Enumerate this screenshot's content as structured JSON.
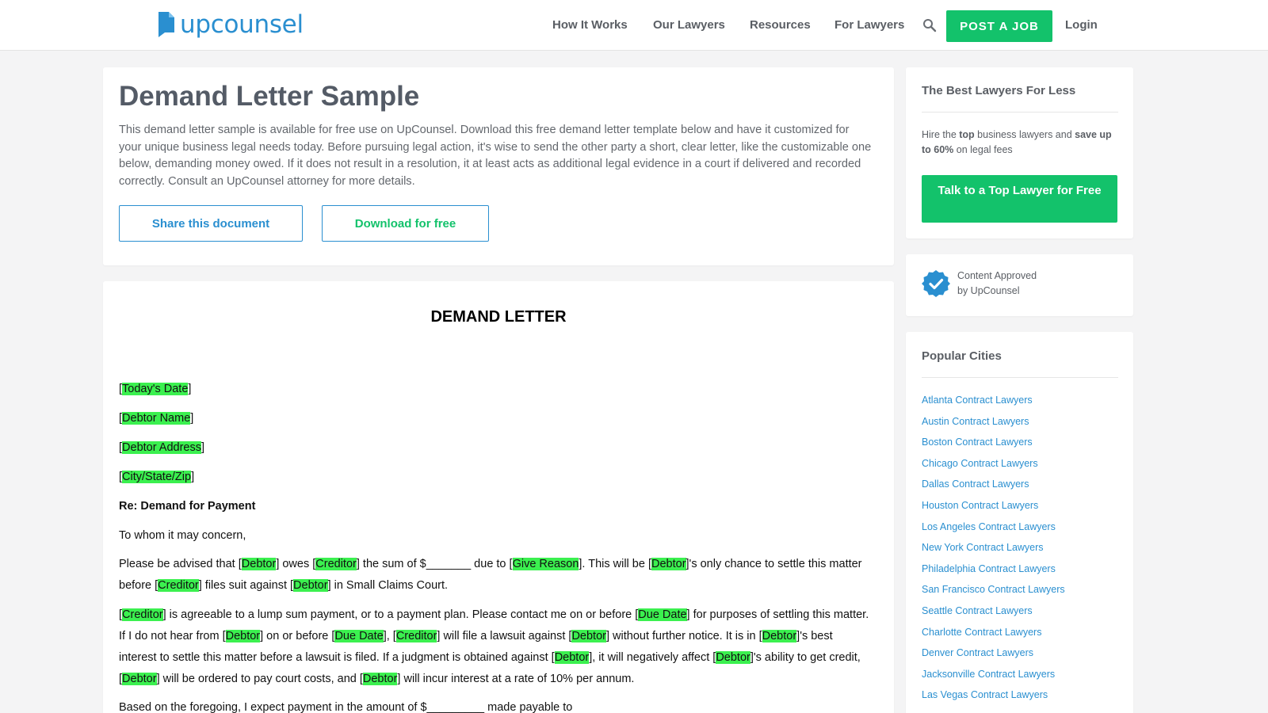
{
  "header": {
    "logo_text": "upcounsel",
    "nav": [
      "How It Works",
      "Our Lawyers",
      "Resources",
      "For Lawyers"
    ],
    "post_job": "POST A JOB",
    "login": "Login",
    "icons": [
      "logo-icon",
      "search-icon"
    ]
  },
  "intro": {
    "title": "Demand Letter Sample",
    "description": "This demand letter sample is available for free use on UpCounsel. Download this free demand letter template below and have it customized for your unique business legal needs today. Before pursuing legal action, it's wise to send the other party a short, clear letter, like the customizable one below, demanding money owed. If it does not result in a resolution, it at least acts as additional legal evidence in a court if delivered and recorded correctly. Consult an UpCounsel attorney for more details.",
    "share": "Share this document",
    "download": "Download for free"
  },
  "letter": {
    "title": "DEMAND LETTER",
    "fields": [
      "Today's Date",
      "Debtor Name",
      "Debtor Address",
      "City/State/Zip"
    ],
    "re": "Re: Demand for Payment",
    "greeting": "To whom it may concern,",
    "p1": [
      {
        "t": "Please be advised that ["
      },
      {
        "h": "Debtor"
      },
      {
        "t": "] owes ["
      },
      {
        "h": "Creditor"
      },
      {
        "t": "] the sum of $_______ due to ["
      },
      {
        "h": "Give Reason"
      },
      {
        "t": "]. This will be ["
      },
      {
        "h": "Debtor"
      },
      {
        "t": "]'s only chance to settle this matter"
      }
    ],
    "p1b": [
      {
        "t": "before ["
      },
      {
        "h": "Creditor"
      },
      {
        "t": "] files suit against ["
      },
      {
        "h": "Debtor"
      },
      {
        "t": "] in Small Claims Court."
      }
    ],
    "p2a": [
      {
        "t": "["
      },
      {
        "h": "Creditor"
      },
      {
        "t": "] is agreeable to a lump sum payment, or to a payment plan. Please contact me on or before ["
      },
      {
        "h": "Due Date"
      },
      {
        "t": "] for purposes of settling this matter."
      }
    ],
    "p2b": [
      {
        "t": "If I do not hear from ["
      },
      {
        "h": "Debtor"
      },
      {
        "t": "] on or before ["
      },
      {
        "h": "Due Date"
      },
      {
        "t": "], ["
      },
      {
        "h": "Creditor"
      },
      {
        "t": "] will file a lawsuit against ["
      },
      {
        "h": "Debtor"
      },
      {
        "t": "] without further notice. It is in ["
      },
      {
        "h": "Debtor"
      },
      {
        "t": "]'s best"
      }
    ],
    "p2c": [
      {
        "t": "interest to settle this matter before a lawsuit is filed. If a judgment is obtained against ["
      },
      {
        "h": "Debtor"
      },
      {
        "t": "], it will negatively affect ["
      },
      {
        "h": "Debtor"
      },
      {
        "t": "]'s ability to get credit,"
      }
    ],
    "p2d": [
      {
        "t": "["
      },
      {
        "h": "Debtor"
      },
      {
        "t": "] will be ordered to pay court costs, and ["
      },
      {
        "h": "Debtor"
      },
      {
        "t": "] will incur interest at a rate of 10% per annum."
      }
    ],
    "p3": "Based on the foregoing, I expect payment in the amount of $_________ made payable to"
  },
  "sidebar": {
    "best_title": "The Best Lawyers For Less",
    "hire": [
      {
        "t": "Hire the "
      },
      {
        "b": "top"
      },
      {
        "t": " business lawyers and "
      },
      {
        "b": "save up to 60%"
      },
      {
        "t": " on legal fees"
      }
    ],
    "talk": "Talk to a Top Lawyer for Free",
    "approved_line1": "Content Approved",
    "approved_line2": "by UpCounsel",
    "cities_title": "Popular Cities",
    "cities": [
      "Atlanta Contract Lawyers",
      "Austin Contract Lawyers",
      "Boston Contract Lawyers",
      "Chicago Contract Lawyers",
      "Dallas Contract Lawyers",
      "Houston Contract Lawyers",
      "Los Angeles Contract Lawyers",
      "New York Contract Lawyers",
      "Philadelphia Contract Lawyers",
      "San Francisco Contract Lawyers",
      "Seattle Contract Lawyers",
      "Charlotte Contract Lawyers",
      "Denver Contract Lawyers",
      "Jacksonville Contract Lawyers",
      "Las Vegas Contract Lawyers"
    ]
  },
  "colors": {
    "brand_blue": "#2a8fd0",
    "brand_green": "#13c26b",
    "highlight": "#3bf04f"
  }
}
